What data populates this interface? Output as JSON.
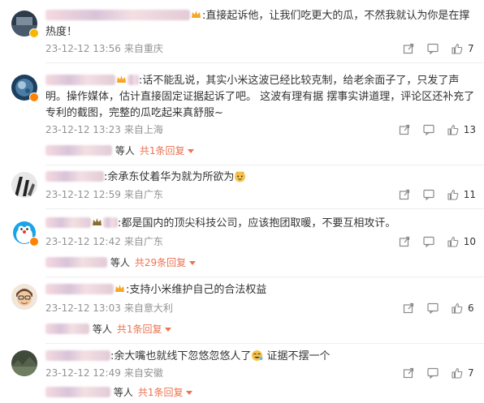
{
  "colors": {
    "accent": "#eb7350",
    "meta": "#939393",
    "text": "#333333"
  },
  "comments": [
    {
      "text": "直接起诉他，让我们吃更大的瓜，不然我就认为你是在撑热度！",
      "date": "23-12-12 13:56",
      "location": "来自重庆",
      "likes": "7",
      "badge": "crown-icon"
    },
    {
      "text": "话不能乱说，其实小米这波已经比较克制，给老余面子了，只发了声明。操作媒体，估计直接固定证据起诉了吧。  这波有理有据 摆事实讲道理，评论区还补充了专利的截图，完整的瓜吃起来真舒服~",
      "date": "23-12-12 13:23",
      "location": "来自上海",
      "likes": "13",
      "badge": "crown-icon",
      "replies_suffix": "等人",
      "replies_link": "共1条回复"
    },
    {
      "text": "余承东仗着华为就为所欲为",
      "date": "23-12-12 12:59",
      "location": "来自广东",
      "likes": "11"
    },
    {
      "text": "都是国内的顶尖科技公司，应该抱团取暖，不要互相攻讦。",
      "date": "23-12-12 12:42",
      "location": "来自广东",
      "likes": "10",
      "replies_suffix": "等人",
      "replies_link": "共29条回复"
    },
    {
      "text": "支持小米维护自己的合法权益",
      "date": "23-12-12 13:03",
      "location": "来自意大利",
      "likes": "6",
      "replies_suffix": "等人",
      "replies_link": "共1条回复"
    },
    {
      "text_a": "余大嘴也就线下忽悠忽悠人了",
      "text_b": " 证据不摆一个",
      "date": "23-12-12 12:49",
      "location": "来自安徽",
      "likes": "7",
      "replies_suffix": "等人",
      "replies_link": "共1条回复"
    }
  ]
}
